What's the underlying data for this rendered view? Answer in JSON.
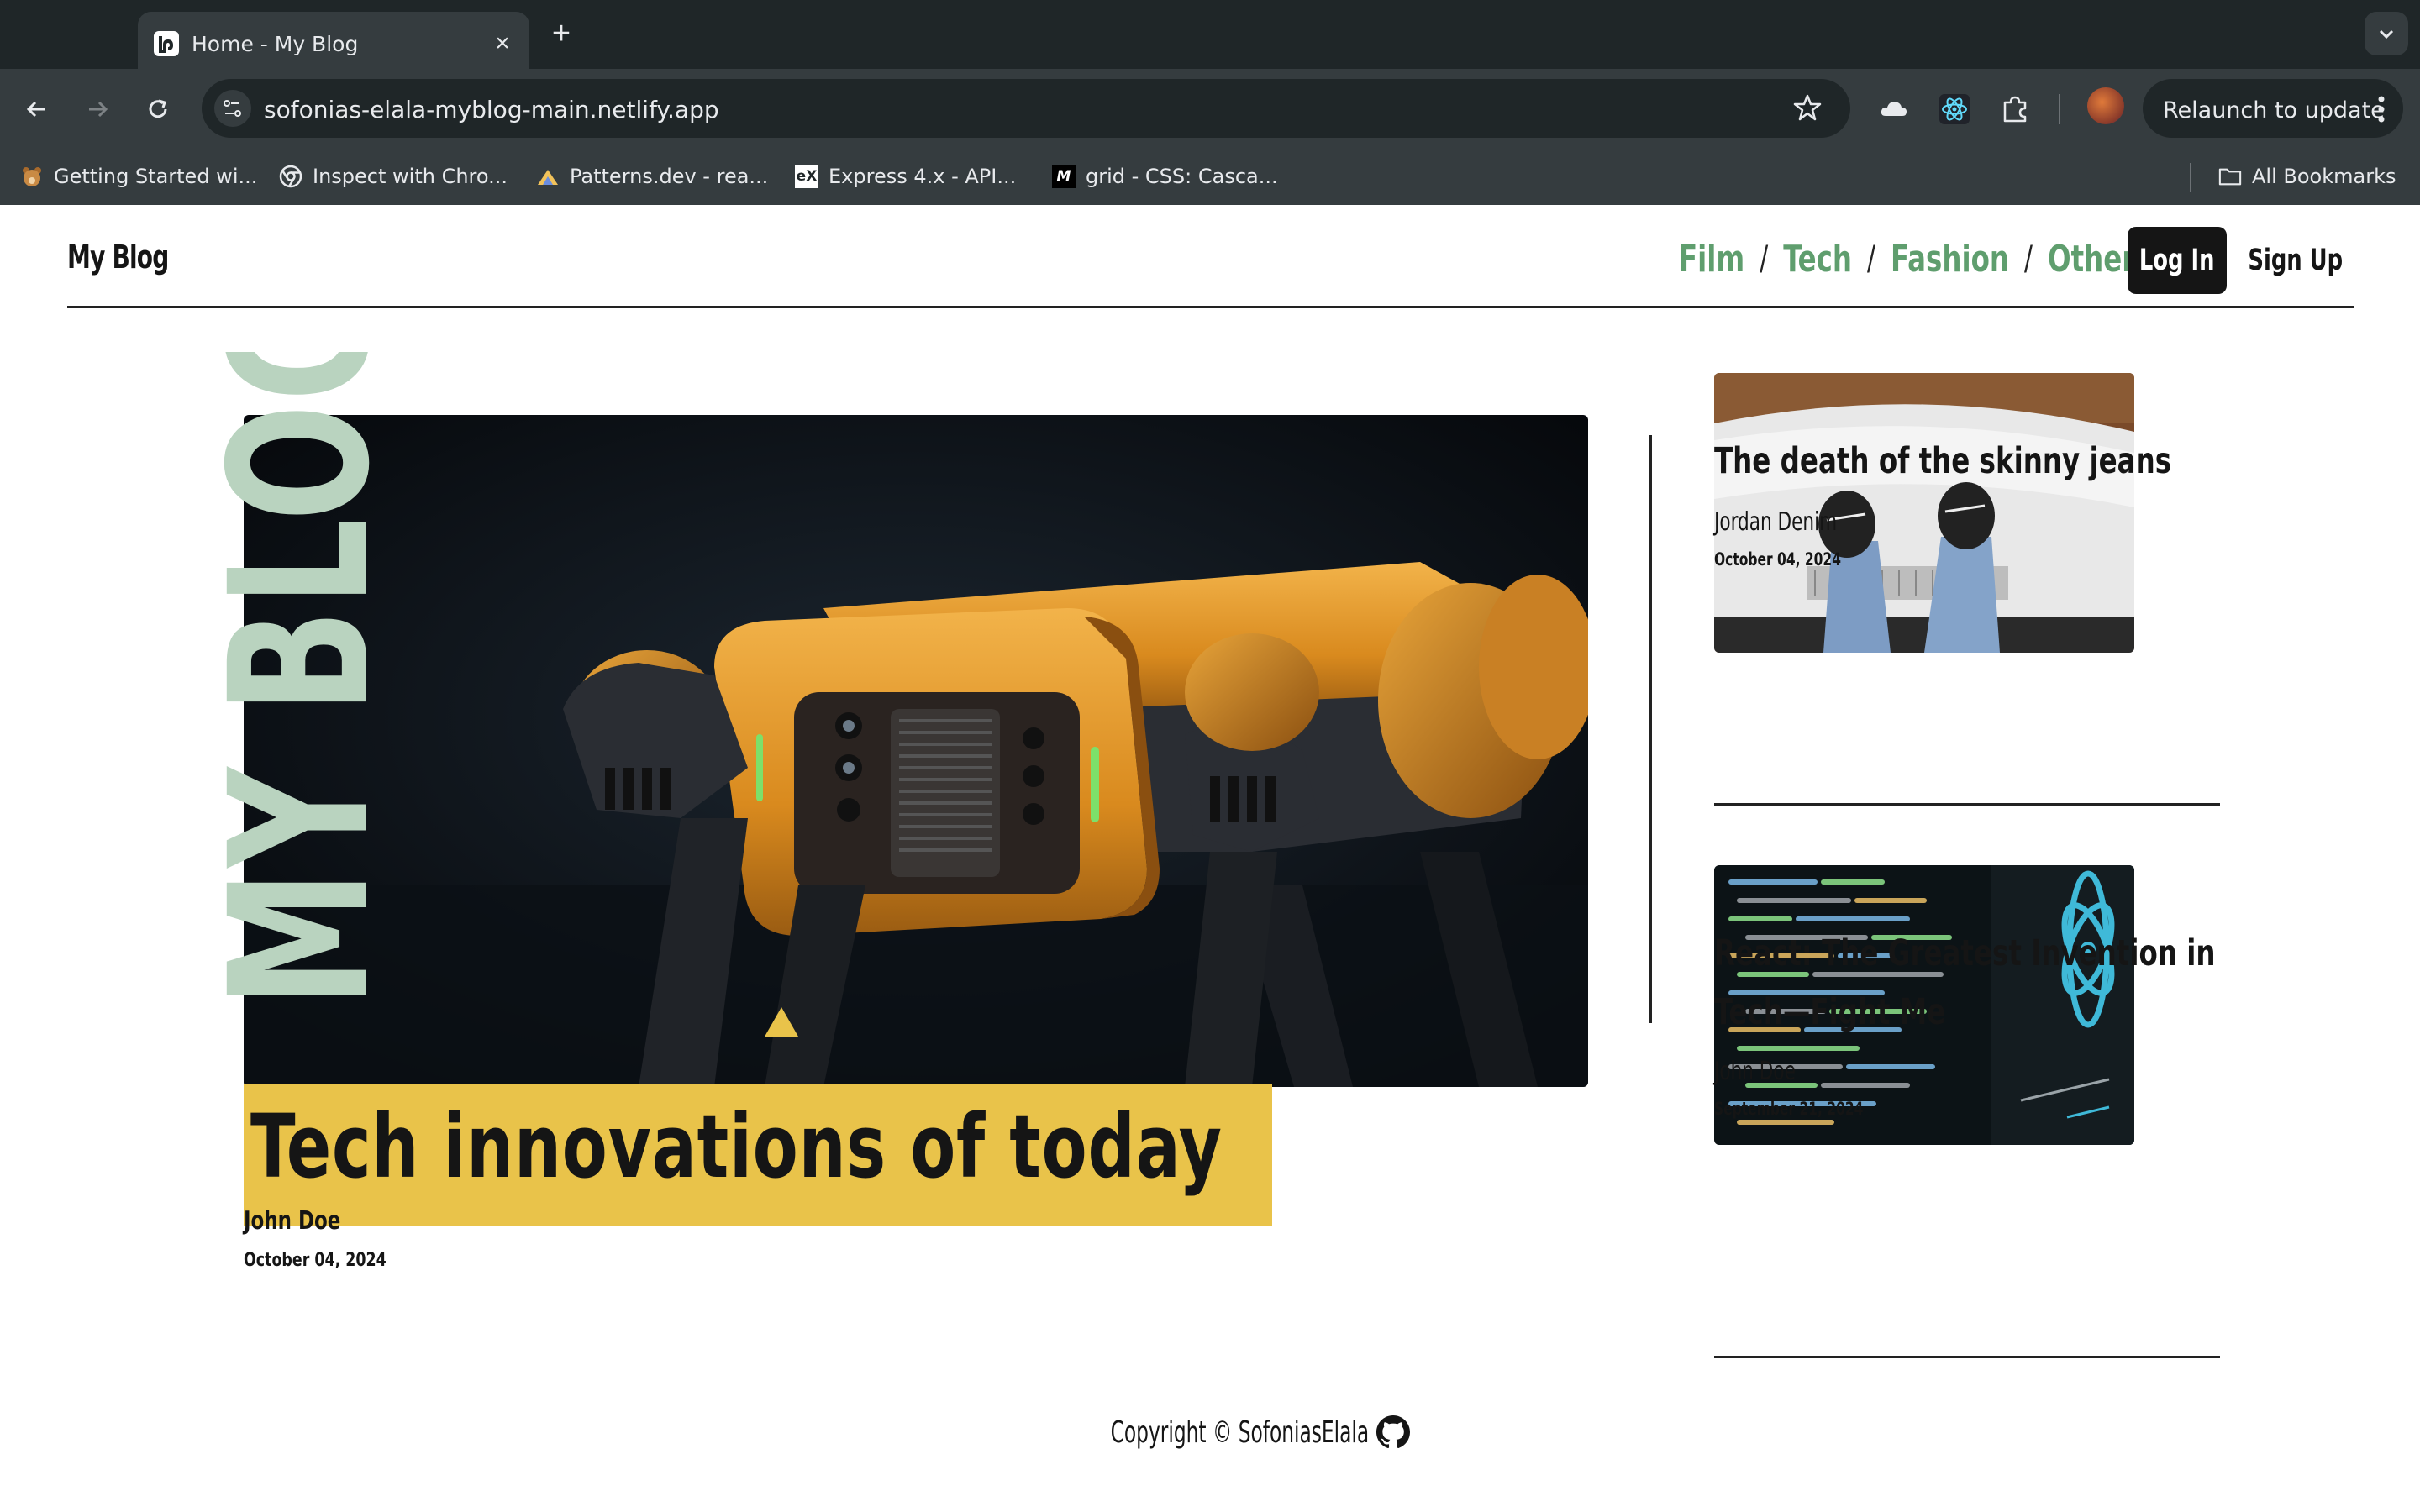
{
  "browser": {
    "tab_title": "Home - My Blog",
    "url": "sofonias-elala-myblog-main.netlify.app",
    "relaunch_label": "Relaunch to update",
    "bookmarks": [
      {
        "label": "Getting Started wi...",
        "icon": "bear-favicon"
      },
      {
        "label": "Inspect with Chro...",
        "icon": "chrome-favicon"
      },
      {
        "label": "Patterns.dev - rea...",
        "icon": "patterns-favicon"
      },
      {
        "label": "Express 4.x - API...",
        "icon": "express-favicon"
      },
      {
        "label": "grid - CSS: Casca...",
        "icon": "mdn-favicon"
      }
    ],
    "all_bookmarks_label": "All Bookmarks"
  },
  "site": {
    "brand": "My Blog",
    "nav": {
      "categories": [
        "Film",
        "Tech",
        "Fashion",
        "Other"
      ],
      "separator": "/",
      "login_label": "Log In",
      "signup_label": "Sign Up"
    },
    "vertical_logo": "MY BLOG",
    "featured": {
      "title": "Tech innovations of today",
      "author": "John Doe",
      "date": "October 04, 2024",
      "image": "robot-dog-photo"
    },
    "sidebar_posts": [
      {
        "title": "The death of the skinny jeans",
        "author": "Jordan Denim",
        "date": "October 04, 2024",
        "image": "jeans-on-car-hood-photo"
      },
      {
        "title": "React: The Greatest Invention in Tech—Fight Me",
        "author": "John Doe",
        "date": "September 21, 2024",
        "image": "react-code-screen-photo"
      }
    ],
    "footer": {
      "copyright": "Copyright © SofoniasElala",
      "icon": "github-icon"
    }
  },
  "colors": {
    "accent_green": "#5f9e6e",
    "logo_green": "#b9d3bf",
    "title_highlight": "#e9c34a",
    "dark": "#151515",
    "chrome_bg": "#1f2628",
    "chrome_toolbar": "#353c3f"
  }
}
